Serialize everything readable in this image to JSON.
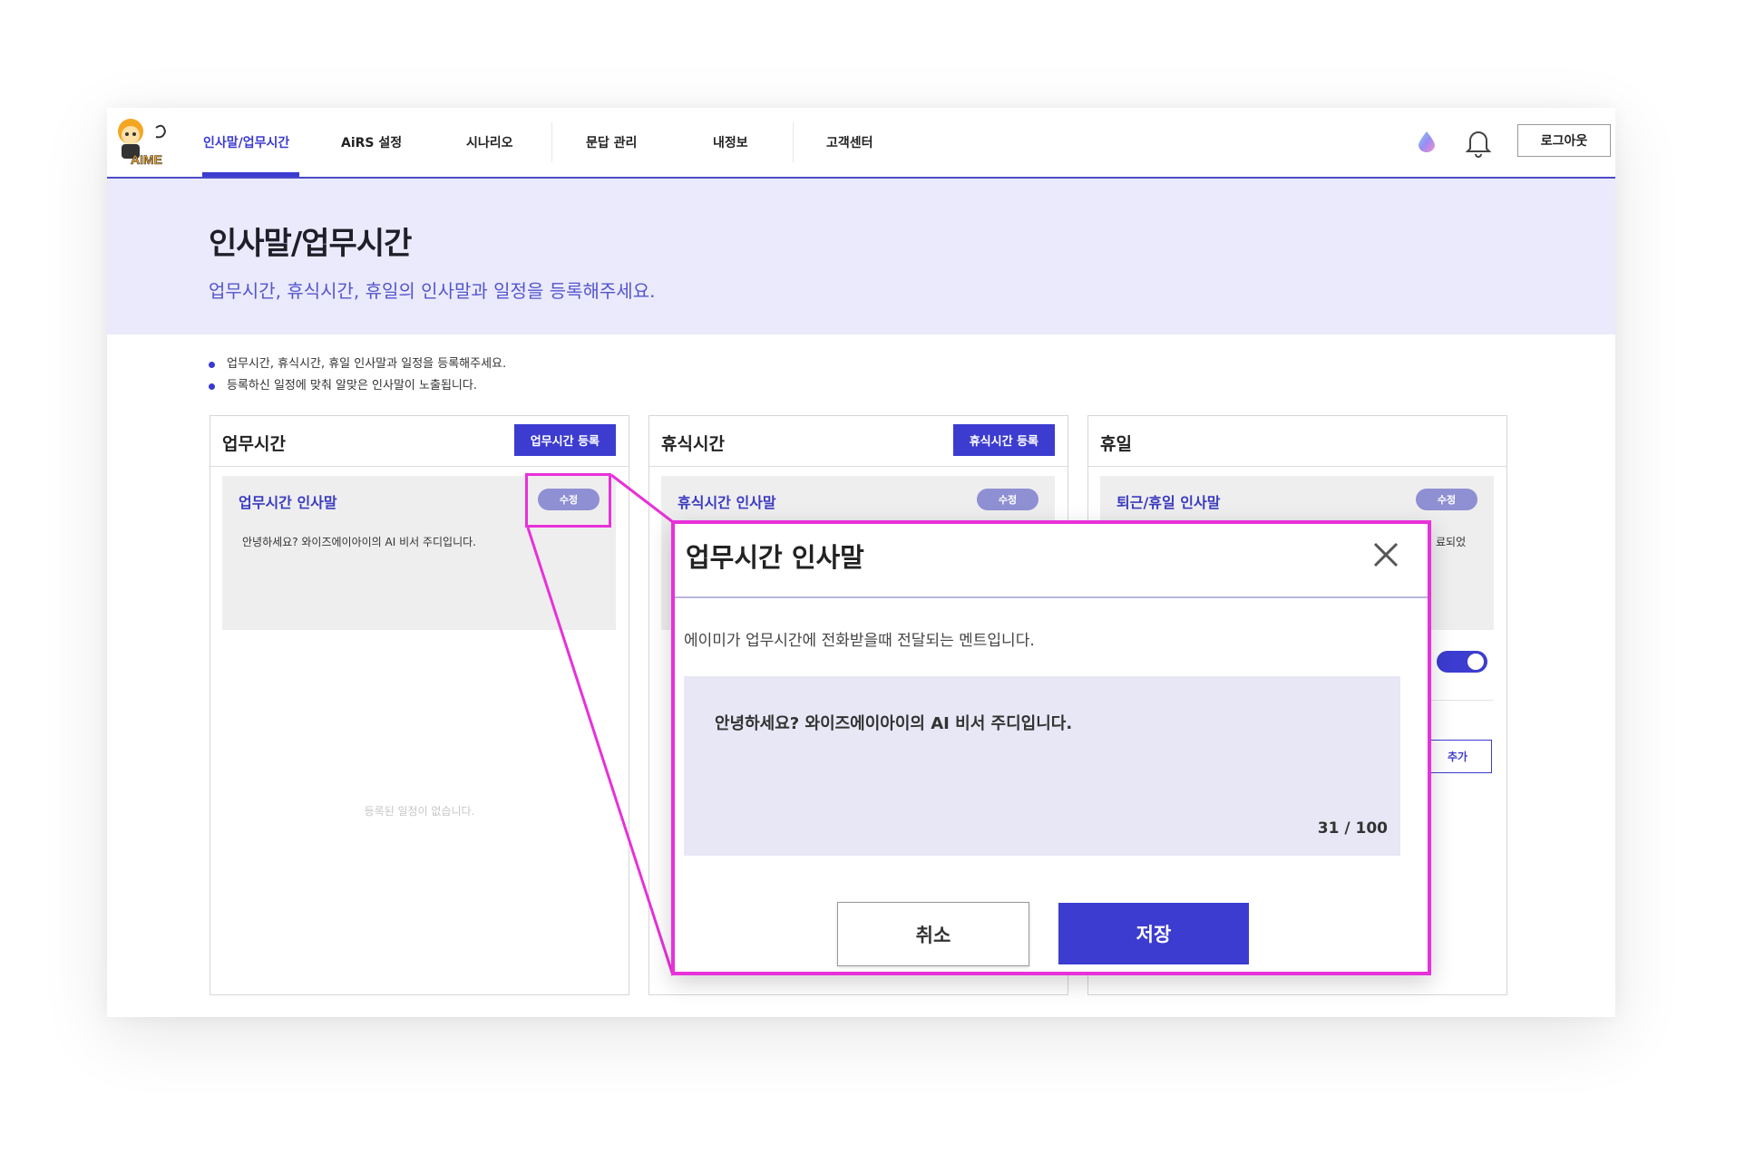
{
  "header": {
    "logo_text": "AIME",
    "nav": [
      {
        "label": "인사말/업무시간",
        "active": true
      },
      {
        "label": "AiRS 설정",
        "active": false
      },
      {
        "label": "시나리오",
        "active": false
      },
      {
        "label": "문답 관리",
        "active": false
      },
      {
        "label": "내정보",
        "active": false
      },
      {
        "label": "고객센터",
        "active": false
      }
    ],
    "logout_label": "로그아웃"
  },
  "hero": {
    "title": "인사말/업무시간",
    "subtitle": "업무시간, 휴식시간, 휴일의 인사말과 일정을 등록해주세요."
  },
  "notes": [
    "업무시간, 휴식시간, 휴일 인사말과 일정을 등록해주세요.",
    "등록하신 일정에 맞춰 알맞은 인사말이 노출됩니다."
  ],
  "panels": [
    {
      "title": "업무시간",
      "register_label": "업무시간 등록",
      "greeting_title": "업무시간 인사말",
      "edit_label": "수정",
      "greeting_text": "안녕하세요? 와이즈에이아이의 AI 비서 주디입니다.",
      "empty_message": "등록된 일정이 없습니다."
    },
    {
      "title": "휴식시간",
      "register_label": "휴식시간 등록",
      "greeting_title": "휴식시간 인사말",
      "edit_label": "수정"
    },
    {
      "title": "휴일",
      "greeting_title": "퇴근/휴일 인사말",
      "edit_label": "수정",
      "greeting_text_partial": "료되었",
      "toggle_on": true,
      "add_label": "추가"
    }
  ],
  "modal": {
    "title": "업무시간 인사말",
    "description": "에이미가 업무시간에 전화받을때 전달되는 멘트입니다.",
    "message": "안녕하세요? 와이즈에이아이의 AI 비서  주디입니다.",
    "char_count": "31 / 100",
    "cancel_label": "취소",
    "save_label": "저장"
  },
  "colors": {
    "accent": "#3c3cd0",
    "hero_bg": "#eaeafc",
    "callout": "#e831d9",
    "edit_pill": "#8f8fd3"
  }
}
